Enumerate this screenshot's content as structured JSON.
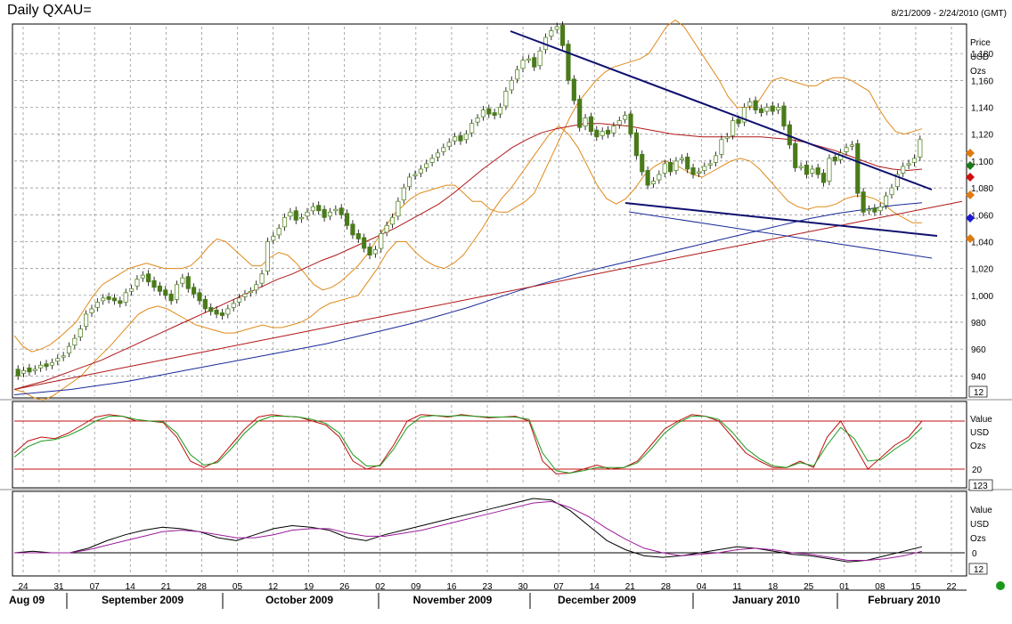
{
  "header": {
    "title": "Daily QXAU=",
    "date_range": "8/21/2009 - 2/24/2010 (GMT)"
  },
  "colors": {
    "bull": "#5a8a2a",
    "bear": "#4a7a1a",
    "bollinger": "#e08a1a",
    "ma_red": "#b01818",
    "ma_blue": "#1a2a9a",
    "trendline": "#101070",
    "stoch_k": "#c01010",
    "stoch_d": "#1a9a1a",
    "stoch_band": "#c01010",
    "macd": "#000000",
    "macd_signal": "#9a1a9a",
    "grid": "#888888"
  },
  "price_axis": {
    "unit_labels": [
      "Price",
      "USD",
      "Ozs"
    ],
    "ticks": [
      940,
      960,
      980,
      1000,
      1020,
      1040,
      1060,
      1080,
      1100,
      1120,
      1140,
      1160,
      1180
    ],
    "ylim": [
      925,
      1200
    ],
    "box_label": "12"
  },
  "stoch_axis": {
    "unit_labels": [
      "Value",
      "USD",
      "Ozs"
    ],
    "ticks": [
      20
    ],
    "ylim": [
      0,
      100
    ],
    "box_label": "123"
  },
  "macd_axis": {
    "unit_labels": [
      "Value",
      "USD",
      "Ozs"
    ],
    "ticks": [
      0
    ],
    "box_label": "12"
  },
  "x_axis": {
    "day_ticks": [
      "24",
      "31",
      "07",
      "14",
      "21",
      "28",
      "05",
      "12",
      "19",
      "26",
      "02",
      "09",
      "16",
      "23",
      "30",
      "07",
      "14",
      "21",
      "28",
      "04",
      "11",
      "18",
      "25",
      "01",
      "08",
      "15",
      "22"
    ],
    "months": [
      "Aug 09",
      "September 2009",
      "October 2009",
      "November 2009",
      "December 2009",
      "January 2010",
      "February 2010"
    ]
  },
  "chart_data": [
    {
      "type": "candlestick",
      "name": "price",
      "ohlc_close": [
        940,
        944,
        943,
        945,
        948,
        947,
        950,
        953,
        955,
        962,
        968,
        975,
        986,
        990,
        995,
        998,
        997,
        996,
        994,
        1002,
        1005,
        1012,
        1015,
        1010,
        1006,
        1003,
        1000,
        996,
        1008,
        1013,
        1005,
        1001,
        996,
        990,
        988,
        986,
        985,
        990,
        994,
        998,
        1001,
        1003,
        1008,
        1016,
        1040,
        1044,
        1050,
        1058,
        1062,
        1056,
        1058,
        1062,
        1066,
        1063,
        1058,
        1062,
        1064,
        1060,
        1052,
        1045,
        1042,
        1035,
        1030,
        1034,
        1046,
        1052,
        1058,
        1070,
        1080,
        1088,
        1090,
        1094,
        1098,
        1102,
        1106,
        1110,
        1114,
        1118,
        1115,
        1120,
        1128,
        1132,
        1138,
        1135,
        1134,
        1140,
        1152,
        1160,
        1168,
        1175,
        1176,
        1170,
        1182,
        1192,
        1197,
        1200,
        1186,
        1160,
        1145,
        1125,
        1132,
        1122,
        1118,
        1122,
        1120,
        1126,
        1130,
        1134,
        1120,
        1104,
        1092,
        1082,
        1085,
        1090,
        1098,
        1092,
        1100,
        1102,
        1094,
        1090,
        1092,
        1096,
        1098,
        1104,
        1116,
        1118,
        1130,
        1128,
        1140,
        1144,
        1138,
        1136,
        1140,
        1137,
        1140,
        1126,
        1112,
        1095,
        1096,
        1090,
        1094,
        1090,
        1084,
        1102,
        1100,
        1106,
        1110,
        1112,
        1076,
        1062,
        1064,
        1062,
        1066,
        1074,
        1080,
        1090,
        1096,
        1098,
        1102,
        1116
      ],
      "ohlc_open": [
        945,
        942,
        946,
        944,
        946,
        949,
        948,
        951,
        954,
        957,
        963,
        969,
        977,
        987,
        991,
        996,
        999,
        998,
        996,
        995,
        1003,
        1007,
        1013,
        1016,
        1011,
        1007,
        1004,
        1001,
        997,
        1009,
        1014,
        1006,
        1002,
        997,
        991,
        989,
        987,
        986,
        991,
        995,
        999,
        1002,
        1004,
        1009,
        1018,
        1041,
        1045,
        1051,
        1059,
        1063,
        1057,
        1059,
        1063,
        1067,
        1064,
        1059,
        1063,
        1065,
        1061,
        1053,
        1046,
        1043,
        1036,
        1031,
        1035,
        1047,
        1053,
        1059,
        1071,
        1081,
        1089,
        1091,
        1095,
        1099,
        1103,
        1107,
        1111,
        1115,
        1119,
        1116,
        1121,
        1129,
        1133,
        1139,
        1136,
        1135,
        1141,
        1153,
        1161,
        1169,
        1176,
        1177,
        1171,
        1183,
        1193,
        1198,
        1201,
        1187,
        1161,
        1146,
        1126,
        1133,
        1123,
        1119,
        1123,
        1121,
        1127,
        1131,
        1135,
        1121,
        1105,
        1093,
        1083,
        1086,
        1091,
        1099,
        1093,
        1101,
        1103,
        1095,
        1091,
        1093,
        1097,
        1099,
        1105,
        1117,
        1119,
        1131,
        1129,
        1141,
        1145,
        1139,
        1137,
        1141,
        1138,
        1141,
        1127,
        1113,
        1096,
        1097,
        1091,
        1095,
        1091,
        1085,
        1103,
        1101,
        1107,
        1111,
        1113,
        1077,
        1063,
        1065,
        1063,
        1067,
        1075,
        1081,
        1091,
        1097,
        1099,
        1103
      ],
      "price_ylim": [
        925,
        1200
      ],
      "bollinger_upper": [
        970,
        962,
        958,
        960,
        963,
        968,
        974,
        980,
        990,
        1000,
        1008,
        1012,
        1016,
        1020,
        1022,
        1024,
        1022,
        1020,
        1020,
        1020,
        1022,
        1028,
        1036,
        1042,
        1040,
        1034,
        1028,
        1022,
        1022,
        1028,
        1032,
        1030,
        1024,
        1016,
        1008,
        1004,
        1006,
        1010,
        1016,
        1022,
        1030,
        1040,
        1050,
        1060,
        1066,
        1072,
        1076,
        1078,
        1080,
        1082,
        1082,
        1076,
        1070,
        1070,
        1064,
        1062,
        1062,
        1066,
        1070,
        1076,
        1090,
        1104,
        1118,
        1132,
        1144,
        1152,
        1160,
        1166,
        1170,
        1172,
        1174,
        1176,
        1180,
        1190,
        1200,
        1205,
        1200,
        1190,
        1180,
        1170,
        1160,
        1148,
        1140,
        1140,
        1140,
        1150,
        1160,
        1162,
        1160,
        1158,
        1156,
        1156,
        1160,
        1162,
        1162,
        1160,
        1156,
        1152,
        1140,
        1130,
        1122,
        1120,
        1122,
        1124
      ],
      "bollinger_lower": [
        930,
        928,
        924,
        922,
        925,
        930,
        935,
        940,
        948,
        955,
        962,
        970,
        978,
        986,
        990,
        992,
        990,
        986,
        982,
        978,
        976,
        974,
        972,
        972,
        974,
        976,
        978,
        976,
        976,
        978,
        980,
        984,
        990,
        994,
        996,
        998,
        1000,
        1010,
        1020,
        1032,
        1040,
        1040,
        1032,
        1026,
        1022,
        1020,
        1024,
        1030,
        1040,
        1050,
        1062,
        1072,
        1080,
        1090,
        1100,
        1110,
        1120,
        1126,
        1120,
        1110,
        1096,
        1082,
        1072,
        1068,
        1072,
        1080,
        1090,
        1096,
        1100,
        1098,
        1094,
        1090,
        1088,
        1092,
        1096,
        1100,
        1102,
        1100,
        1094,
        1086,
        1078,
        1070,
        1066,
        1064,
        1066,
        1066,
        1068,
        1072,
        1074,
        1074,
        1072,
        1068,
        1062,
        1058,
        1054,
        1054
      ],
      "ma_red": [
        930,
        933,
        936,
        940,
        944,
        948,
        952,
        957,
        962,
        967,
        972,
        977,
        982,
        987,
        992,
        997,
        1002,
        1007,
        1012,
        1016,
        1021,
        1026,
        1030,
        1035,
        1040,
        1045,
        1050,
        1056,
        1062,
        1068,
        1076,
        1085,
        1094,
        1102,
        1110,
        1116,
        1121,
        1124,
        1126,
        1128,
        1128,
        1127,
        1126,
        1124,
        1122,
        1120,
        1119,
        1118,
        1118,
        1118,
        1118,
        1118,
        1117,
        1116,
        1114,
        1111,
        1108,
        1104,
        1100,
        1096,
        1094,
        1093,
        1094
      ],
      "ma_blue": [
        926,
        928,
        930,
        933,
        936,
        940,
        944,
        948,
        952,
        956,
        960,
        964,
        969,
        974,
        979,
        985,
        991,
        998,
        1005,
        1011,
        1017,
        1022,
        1027,
        1032,
        1037,
        1042,
        1047,
        1052,
        1057,
        1061,
        1064,
        1067,
        1069
      ],
      "ma_red_long": [
        930,
        935,
        940,
        945,
        950,
        955,
        960,
        965,
        970,
        975,
        980,
        985,
        990,
        995,
        1000,
        1005,
        1010,
        1015,
        1020,
        1025,
        1030,
        1035,
        1040,
        1045,
        1050,
        1055,
        1060,
        1065,
        1070
      ]
    },
    {
      "type": "line",
      "name": "stochastic",
      "ylim": [
        0,
        100
      ],
      "bands": [
        20,
        80
      ],
      "series": [
        {
          "values": [
            40,
            55,
            60,
            58,
            65,
            75,
            85,
            88,
            86,
            80,
            80,
            78,
            60,
            30,
            22,
            30,
            50,
            70,
            85,
            88,
            86,
            85,
            80,
            75,
            60,
            30,
            20,
            25,
            50,
            80,
            88,
            87,
            85,
            88,
            86,
            84,
            85,
            86,
            80,
            30,
            14,
            15,
            20,
            25,
            20,
            22,
            30,
            50,
            70,
            80,
            88,
            86,
            80,
            60,
            40,
            30,
            22,
            22,
            30,
            22,
            60,
            80,
            50,
            20,
            35,
            50,
            60,
            80
          ]
        },
        {
          "values": [
            35,
            48,
            55,
            57,
            62,
            70,
            80,
            86,
            86,
            82,
            80,
            79,
            65,
            38,
            25,
            28,
            45,
            65,
            80,
            86,
            86,
            85,
            82,
            77,
            65,
            38,
            24,
            24,
            45,
            72,
            85,
            87,
            86,
            87,
            86,
            85,
            85,
            85,
            82,
            40,
            18,
            15,
            18,
            22,
            22,
            22,
            28,
            45,
            65,
            78,
            86,
            86,
            82,
            66,
            46,
            33,
            24,
            22,
            28,
            24,
            50,
            72,
            58,
            30,
            32,
            45,
            56,
            72
          ]
        }
      ]
    },
    {
      "type": "line",
      "name": "macd",
      "series": [
        {
          "values": [
            0,
            1,
            0,
            0,
            3,
            8,
            12,
            15,
            17,
            16,
            14,
            10,
            8,
            12,
            16,
            18,
            17,
            15,
            10,
            8,
            12,
            15,
            18,
            21,
            24,
            27,
            30,
            33,
            36,
            35,
            28,
            18,
            8,
            2,
            -2,
            -3,
            -2,
            0,
            2,
            4,
            3,
            1,
            -1,
            -2,
            -4,
            -6,
            -5,
            -2,
            1,
            4
          ]
        },
        {
          "values": [
            0,
            0,
            0,
            0,
            2,
            5,
            8,
            11,
            14,
            15,
            14,
            12,
            10,
            10,
            12,
            15,
            16,
            16,
            13,
            11,
            11,
            13,
            15,
            18,
            21,
            24,
            27,
            30,
            33,
            34,
            30,
            24,
            16,
            9,
            3,
            0,
            -2,
            -1,
            0,
            2,
            3,
            2,
            0,
            -1,
            -3,
            -5,
            -5,
            -4,
            -2,
            1
          ]
        }
      ]
    }
  ]
}
